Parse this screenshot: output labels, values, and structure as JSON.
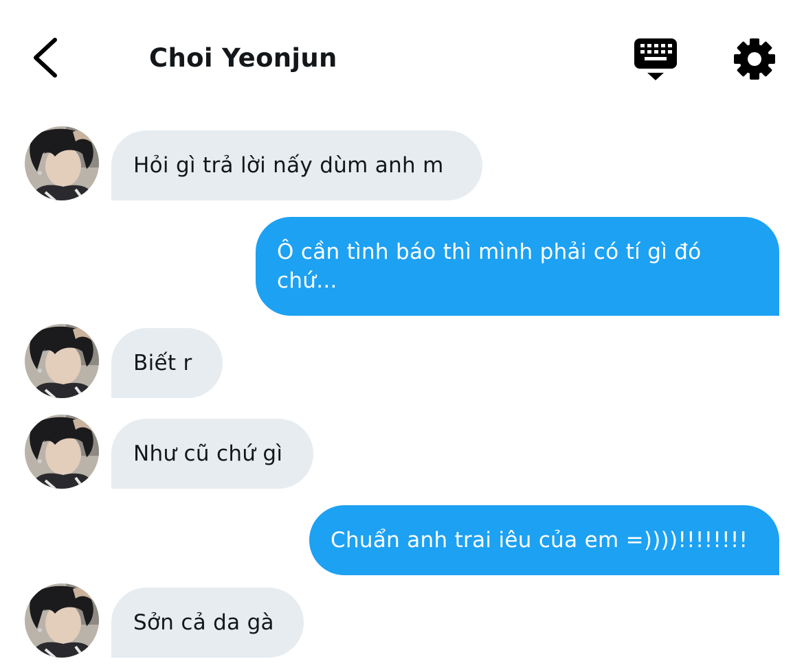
{
  "header": {
    "title": "Choi Yeonjun",
    "back_icon": "chevron-left-icon",
    "keyboard_icon": "keyboard-icon",
    "settings_icon": "gear-icon"
  },
  "colors": {
    "incoming_bubble": "#e6ecf0",
    "outgoing_bubble": "#1da1f2",
    "text_dark": "#14171a",
    "text_light": "#ffffff"
  },
  "messages": [
    {
      "direction": "incoming",
      "text": "Hỏi gì trả lời nấy dùm anh m"
    },
    {
      "direction": "outgoing",
      "text": "Ô cần tình báo thì mình phải có tí gì đó chứ..."
    },
    {
      "direction": "incoming",
      "text": "Biết r"
    },
    {
      "direction": "incoming",
      "text": "Như cũ chứ gì"
    },
    {
      "direction": "outgoing",
      "text": "Chuẩn anh trai iêu của em =))))!!!!!!!!"
    },
    {
      "direction": "incoming",
      "text": "Sởn cả da gà"
    }
  ]
}
